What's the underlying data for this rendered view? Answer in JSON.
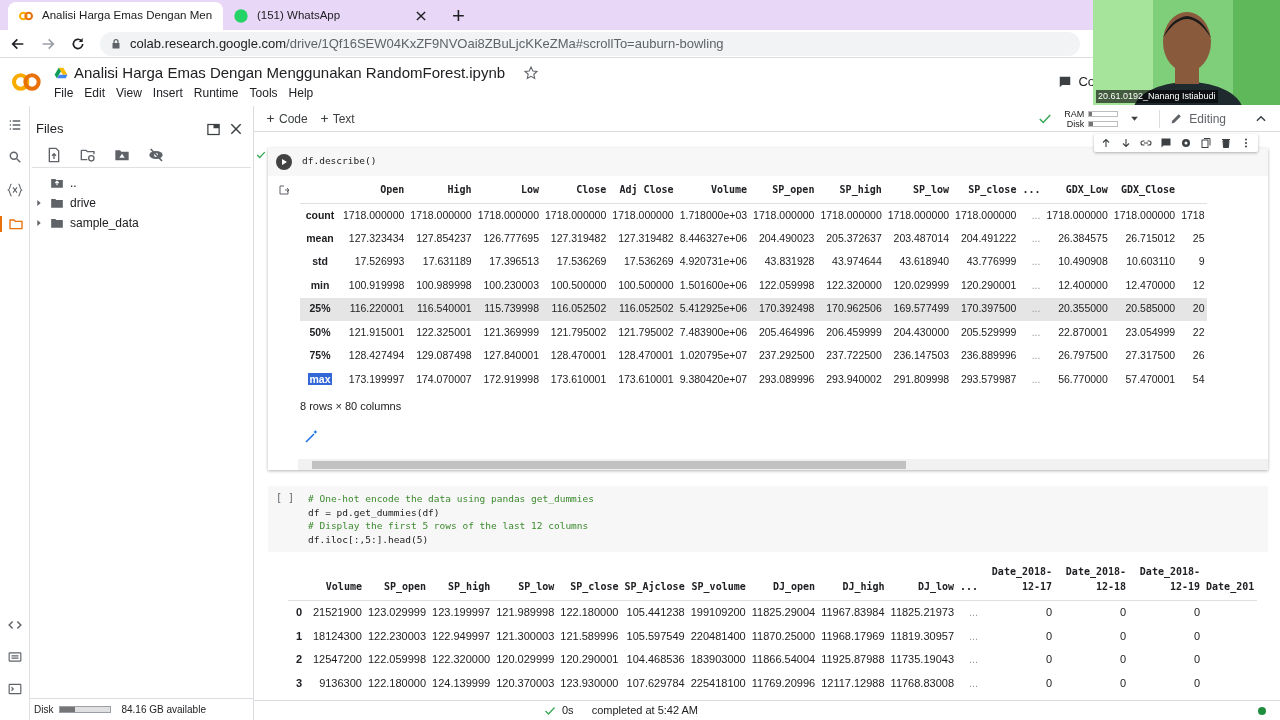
{
  "browser": {
    "tabs": [
      {
        "title": "Analisi Harga Emas Dengan Men",
        "selected": true,
        "kind": "colab"
      },
      {
        "title": "(151) WhatsApp",
        "selected": false,
        "kind": "whatsapp"
      }
    ],
    "new_tab": "+",
    "url_host": "colab.research.google.com",
    "url_path": "/drive/1Qf16SEW04KxZF9NVOai8ZBuLjcKKeZMa#scrollTo=auburn-bowling"
  },
  "notebook": {
    "title": "Analisi Harga Emas Dengan Menggunakan RandomForest.ipynb",
    "menu": [
      "File",
      "Edit",
      "View",
      "Insert",
      "Runtime",
      "Tools",
      "Help"
    ],
    "comment": "Co"
  },
  "toolbar": {
    "add": [
      "Code",
      "Text"
    ],
    "ram": {
      "label": "RAM",
      "level": 0.1
    },
    "disk": {
      "label": "Disk",
      "level": 0.15
    },
    "mode": "Editing"
  },
  "sidebar": {
    "title": "Files",
    "tree": [
      {
        "label": "..",
        "kind": "up"
      },
      {
        "label": "drive",
        "kind": "folder"
      },
      {
        "label": "sample_data",
        "kind": "folder"
      }
    ],
    "disk": {
      "label": "Disk",
      "level": 0.3
    },
    "disk_available": "84.16 GB available"
  },
  "cells": [
    {
      "executed": true,
      "code": [
        {
          "kind": "code",
          "text": "df.describe()"
        }
      ],
      "output": {
        "columns": [
          "Open",
          "High",
          "Low",
          "Close",
          "Adj Close",
          "Volume",
          "SP_open",
          "SP_high",
          "SP_low",
          "SP_close",
          "...",
          "GDX_Low",
          "GDX_Close"
        ],
        "rows": [
          {
            "label": "count",
            "hover": false,
            "label_selected": false,
            "values": [
              "1718.000000",
              "1718.000000",
              "1718.000000",
              "1718.000000",
              "1718.000000",
              "1.718000e+03",
              "1718.000000",
              "1718.000000",
              "1718.000000",
              "1718.000000",
              "...",
              "1718.000000",
              "1718.000000",
              "1718"
            ]
          },
          {
            "label": "mean",
            "hover": false,
            "label_selected": false,
            "values": [
              "127.323434",
              "127.854237",
              "126.777695",
              "127.319482",
              "127.319482",
              "8.446327e+06",
              "204.490023",
              "205.372637",
              "203.487014",
              "204.491222",
              "...",
              "26.384575",
              "26.715012",
              "25"
            ]
          },
          {
            "label": "std",
            "hover": false,
            "label_selected": false,
            "values": [
              "17.526993",
              "17.631189",
              "17.396513",
              "17.536269",
              "17.536269",
              "4.920731e+06",
              "43.831928",
              "43.974644",
              "43.618940",
              "43.776999",
              "...",
              "10.490908",
              "10.603110",
              "9"
            ]
          },
          {
            "label": "min",
            "hover": false,
            "label_selected": false,
            "values": [
              "100.919998",
              "100.989998",
              "100.230003",
              "100.500000",
              "100.500000",
              "1.501600e+06",
              "122.059998",
              "122.320000",
              "120.029999",
              "120.290001",
              "...",
              "12.400000",
              "12.470000",
              "12"
            ]
          },
          {
            "label": "25%",
            "hover": true,
            "label_selected": false,
            "values": [
              "116.220001",
              "116.540001",
              "115.739998",
              "116.052502",
              "116.052502",
              "5.412925e+06",
              "170.392498",
              "170.962506",
              "169.577499",
              "170.397500",
              "...",
              "20.355000",
              "20.585000",
              "20"
            ]
          },
          {
            "label": "50%",
            "hover": false,
            "label_selected": false,
            "values": [
              "121.915001",
              "122.325001",
              "121.369999",
              "121.795002",
              "121.795002",
              "7.483900e+06",
              "205.464996",
              "206.459999",
              "204.430000",
              "205.529999",
              "...",
              "22.870001",
              "23.054999",
              "22"
            ]
          },
          {
            "label": "75%",
            "hover": false,
            "label_selected": false,
            "values": [
              "128.427494",
              "129.087498",
              "127.840001",
              "128.470001",
              "128.470001",
              "1.020795e+07",
              "237.292500",
              "237.722500",
              "236.147503",
              "236.889996",
              "...",
              "26.797500",
              "27.317500",
              "26"
            ]
          },
          {
            "label": "max",
            "hover": false,
            "label_selected": true,
            "values": [
              "173.199997",
              "174.070007",
              "172.919998",
              "173.610001",
              "173.610001",
              "9.380420e+07",
              "293.089996",
              "293.940002",
              "291.809998",
              "293.579987",
              "...",
              "56.770000",
              "57.470001",
              "54"
            ]
          }
        ],
        "summary": "8 rows × 80 columns"
      }
    },
    {
      "executed": false,
      "prompt": "[ ]",
      "code": [
        {
          "kind": "comment",
          "text": "# One-hot encode the data using pandas get_dummies"
        },
        {
          "kind": "code",
          "text": "df = pd.get_dummies(df)"
        },
        {
          "kind": "comment",
          "text": "# Display the first 5 rows of the last 12 columns"
        },
        {
          "kind": "code",
          "text": "df.iloc[:,5:].head(5)"
        }
      ],
      "output": {
        "columns": [
          "Volume",
          "SP_open",
          "SP_high",
          "SP_low",
          "SP_close",
          "SP_Ajclose",
          "SP_volume",
          "DJ_open",
          "DJ_high",
          "DJ_low",
          "...",
          "Date_2018-12-17",
          "Date_2018-12-18",
          "Date_2018-12-19",
          "Date_201"
        ],
        "rows": [
          {
            "label": "0",
            "hover": false,
            "label_selected": false,
            "values": [
              "21521900",
              "123.029999",
              "123.199997",
              "121.989998",
              "122.180000",
              "105.441238",
              "199109200",
              "11825.29004",
              "11967.83984",
              "11825.21973",
              "...",
              "0",
              "0",
              "0"
            ]
          },
          {
            "label": "1",
            "hover": false,
            "label_selected": false,
            "values": [
              "18124300",
              "122.230003",
              "122.949997",
              "121.300003",
              "121.589996",
              "105.597549",
              "220481400",
              "11870.25000",
              "11968.17969",
              "11819.30957",
              "...",
              "0",
              "0",
              "0"
            ]
          },
          {
            "label": "2",
            "hover": false,
            "label_selected": false,
            "values": [
              "12547200",
              "122.059998",
              "122.320000",
              "120.029999",
              "120.290001",
              "104.468536",
              "183903000",
              "11866.54004",
              "11925.87988",
              "11735.19043",
              "...",
              "0",
              "0",
              "0"
            ]
          },
          {
            "label": "3",
            "hover": false,
            "label_selected": false,
            "values": [
              "9136300",
              "122.180000",
              "124.139999",
              "120.370003",
              "123.930000",
              "107.629784",
              "225418100",
              "11769.20996",
              "12117.12988",
              "11768.83008",
              "...",
              "0",
              "0",
              "0"
            ]
          }
        ]
      }
    }
  ],
  "status_bar": {
    "duration": "0s",
    "text": "completed at 5:42 AM",
    "connected": true
  },
  "webcam": {
    "kind": "picture",
    "name": "20.61.0192_Nanang Istiabudi"
  }
}
